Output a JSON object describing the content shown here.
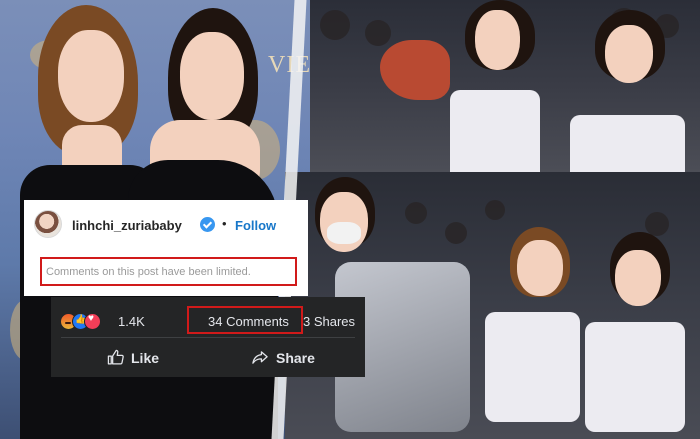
{
  "instagram": {
    "username": "linhchi_zuriababy",
    "dot": "•",
    "follow_label": "Follow",
    "limited_notice": "Comments on this post have been limited.",
    "icons": [
      "avatar",
      "verified-badge-icon"
    ]
  },
  "facebook": {
    "reactions": [
      "angry-reaction-icon",
      "like-reaction-icon",
      "love-reaction-icon"
    ],
    "reaction_count": "1.4K",
    "comments": "34 Comments",
    "shares": "3 Shares",
    "like_label": "Like",
    "share_label": "Share"
  },
  "colors": {
    "highlight": "#d11a1a",
    "follow": "#1877c9",
    "fb_bar": "#242526",
    "verified": "#3897f0"
  },
  "background_sign": "VIE"
}
